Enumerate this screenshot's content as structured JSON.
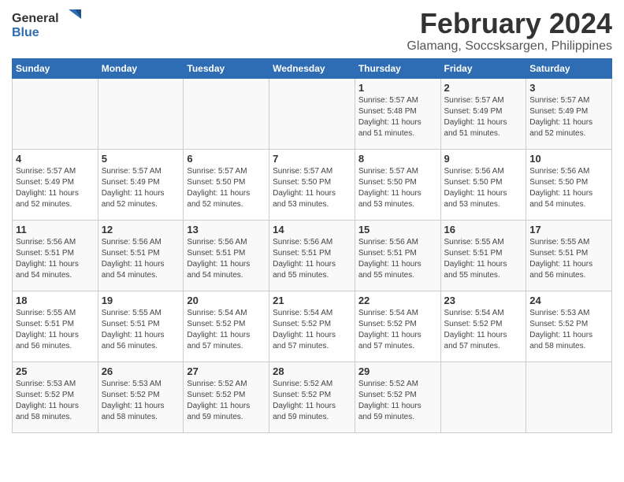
{
  "header": {
    "logo_line1": "General",
    "logo_line2": "Blue",
    "title": "February 2024",
    "subtitle": "Glamang, Soccsksargen, Philippines"
  },
  "days_of_week": [
    "Sunday",
    "Monday",
    "Tuesday",
    "Wednesday",
    "Thursday",
    "Friday",
    "Saturday"
  ],
  "weeks": [
    [
      {
        "day": "",
        "info": ""
      },
      {
        "day": "",
        "info": ""
      },
      {
        "day": "",
        "info": ""
      },
      {
        "day": "",
        "info": ""
      },
      {
        "day": "1",
        "info": "Sunrise: 5:57 AM\nSunset: 5:48 PM\nDaylight: 11 hours\nand 51 minutes."
      },
      {
        "day": "2",
        "info": "Sunrise: 5:57 AM\nSunset: 5:49 PM\nDaylight: 11 hours\nand 51 minutes."
      },
      {
        "day": "3",
        "info": "Sunrise: 5:57 AM\nSunset: 5:49 PM\nDaylight: 11 hours\nand 52 minutes."
      }
    ],
    [
      {
        "day": "4",
        "info": "Sunrise: 5:57 AM\nSunset: 5:49 PM\nDaylight: 11 hours\nand 52 minutes."
      },
      {
        "day": "5",
        "info": "Sunrise: 5:57 AM\nSunset: 5:49 PM\nDaylight: 11 hours\nand 52 minutes."
      },
      {
        "day": "6",
        "info": "Sunrise: 5:57 AM\nSunset: 5:50 PM\nDaylight: 11 hours\nand 52 minutes."
      },
      {
        "day": "7",
        "info": "Sunrise: 5:57 AM\nSunset: 5:50 PM\nDaylight: 11 hours\nand 53 minutes."
      },
      {
        "day": "8",
        "info": "Sunrise: 5:57 AM\nSunset: 5:50 PM\nDaylight: 11 hours\nand 53 minutes."
      },
      {
        "day": "9",
        "info": "Sunrise: 5:56 AM\nSunset: 5:50 PM\nDaylight: 11 hours\nand 53 minutes."
      },
      {
        "day": "10",
        "info": "Sunrise: 5:56 AM\nSunset: 5:50 PM\nDaylight: 11 hours\nand 54 minutes."
      }
    ],
    [
      {
        "day": "11",
        "info": "Sunrise: 5:56 AM\nSunset: 5:51 PM\nDaylight: 11 hours\nand 54 minutes."
      },
      {
        "day": "12",
        "info": "Sunrise: 5:56 AM\nSunset: 5:51 PM\nDaylight: 11 hours\nand 54 minutes."
      },
      {
        "day": "13",
        "info": "Sunrise: 5:56 AM\nSunset: 5:51 PM\nDaylight: 11 hours\nand 54 minutes."
      },
      {
        "day": "14",
        "info": "Sunrise: 5:56 AM\nSunset: 5:51 PM\nDaylight: 11 hours\nand 55 minutes."
      },
      {
        "day": "15",
        "info": "Sunrise: 5:56 AM\nSunset: 5:51 PM\nDaylight: 11 hours\nand 55 minutes."
      },
      {
        "day": "16",
        "info": "Sunrise: 5:55 AM\nSunset: 5:51 PM\nDaylight: 11 hours\nand 55 minutes."
      },
      {
        "day": "17",
        "info": "Sunrise: 5:55 AM\nSunset: 5:51 PM\nDaylight: 11 hours\nand 56 minutes."
      }
    ],
    [
      {
        "day": "18",
        "info": "Sunrise: 5:55 AM\nSunset: 5:51 PM\nDaylight: 11 hours\nand 56 minutes."
      },
      {
        "day": "19",
        "info": "Sunrise: 5:55 AM\nSunset: 5:51 PM\nDaylight: 11 hours\nand 56 minutes."
      },
      {
        "day": "20",
        "info": "Sunrise: 5:54 AM\nSunset: 5:52 PM\nDaylight: 11 hours\nand 57 minutes."
      },
      {
        "day": "21",
        "info": "Sunrise: 5:54 AM\nSunset: 5:52 PM\nDaylight: 11 hours\nand 57 minutes."
      },
      {
        "day": "22",
        "info": "Sunrise: 5:54 AM\nSunset: 5:52 PM\nDaylight: 11 hours\nand 57 minutes."
      },
      {
        "day": "23",
        "info": "Sunrise: 5:54 AM\nSunset: 5:52 PM\nDaylight: 11 hours\nand 57 minutes."
      },
      {
        "day": "24",
        "info": "Sunrise: 5:53 AM\nSunset: 5:52 PM\nDaylight: 11 hours\nand 58 minutes."
      }
    ],
    [
      {
        "day": "25",
        "info": "Sunrise: 5:53 AM\nSunset: 5:52 PM\nDaylight: 11 hours\nand 58 minutes."
      },
      {
        "day": "26",
        "info": "Sunrise: 5:53 AM\nSunset: 5:52 PM\nDaylight: 11 hours\nand 58 minutes."
      },
      {
        "day": "27",
        "info": "Sunrise: 5:52 AM\nSunset: 5:52 PM\nDaylight: 11 hours\nand 59 minutes."
      },
      {
        "day": "28",
        "info": "Sunrise: 5:52 AM\nSunset: 5:52 PM\nDaylight: 11 hours\nand 59 minutes."
      },
      {
        "day": "29",
        "info": "Sunrise: 5:52 AM\nSunset: 5:52 PM\nDaylight: 11 hours\nand 59 minutes."
      },
      {
        "day": "",
        "info": ""
      },
      {
        "day": "",
        "info": ""
      }
    ]
  ]
}
